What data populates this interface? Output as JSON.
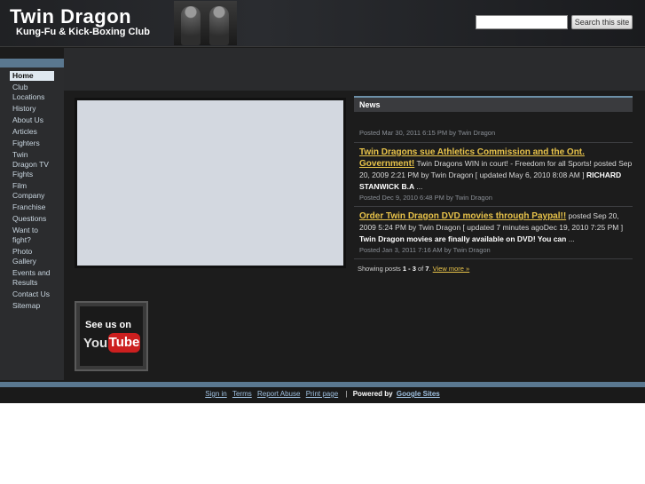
{
  "header": {
    "title": "Twin Dragon",
    "subtitle": "Kung-Fu & Kick-Boxing Club",
    "search_placeholder": "",
    "search_button": "Search this site"
  },
  "sidebar": {
    "items": [
      {
        "label": "Home"
      },
      {
        "label": "Club Locations"
      },
      {
        "label": "History"
      },
      {
        "label": "About Us"
      },
      {
        "label": "Articles"
      },
      {
        "label": "Fighters"
      },
      {
        "label": "Twin Dragon TV Fights"
      },
      {
        "label": "Film Company"
      },
      {
        "label": "Franchise"
      },
      {
        "label": "Questions"
      },
      {
        "label": "Want to fight?"
      },
      {
        "label": "Photo Gallery"
      },
      {
        "label": "Events and Results"
      },
      {
        "label": "Contact Us"
      },
      {
        "label": "Sitemap"
      }
    ]
  },
  "news": {
    "heading": "News",
    "first_meta": "Posted Mar 30, 2011 6:15 PM by Twin Dragon",
    "posts": [
      {
        "title": "Twin Dragons sue Athletics Commission and the Ont. Government!",
        "text": " Twin Dragons WIN in court! - Freedom for all Sports! posted Sep 20, 2009 2:21 PM by Twin Dragon   [ updated May 6, 2010 8:08 AM ] ",
        "strong": "RICHARD STANWICK  B.A ",
        "tail": "...",
        "meta": "Posted Dec 9, 2010 6:48 PM by Twin Dragon"
      },
      {
        "title": "Order Twin Dragon DVD movies through Paypal!!",
        "text": " posted Sep 20, 2009 5:24 PM by Twin Dragon   [ updated 7 minutes agoDec 19, 2010 7:25 PM ] ",
        "strong": "Twin Dragon movies are finally available on DVD! You can ",
        "tail": "...",
        "meta": "Posted Jan 3, 2011 7:16 AM by Twin Dragon"
      }
    ],
    "showing_prefix": "Showing posts ",
    "showing_range": "1 - 3",
    "showing_of": " of ",
    "showing_total": "7",
    "showing_period": ". ",
    "view_more": "View more »"
  },
  "youtube": {
    "see_us_on": "See us on",
    "you": "You",
    "tube": "Tube"
  },
  "footer": {
    "sign_in": "Sign in",
    "terms": "Terms",
    "report_abuse": "Report Abuse",
    "print_page": "Print page",
    "separator": "|",
    "powered_by": "Powered by",
    "google_sites": "Google Sites"
  },
  "colors": {
    "accent": "#5a7890",
    "link": "#e8c34a",
    "background": "#1c1c1c"
  }
}
